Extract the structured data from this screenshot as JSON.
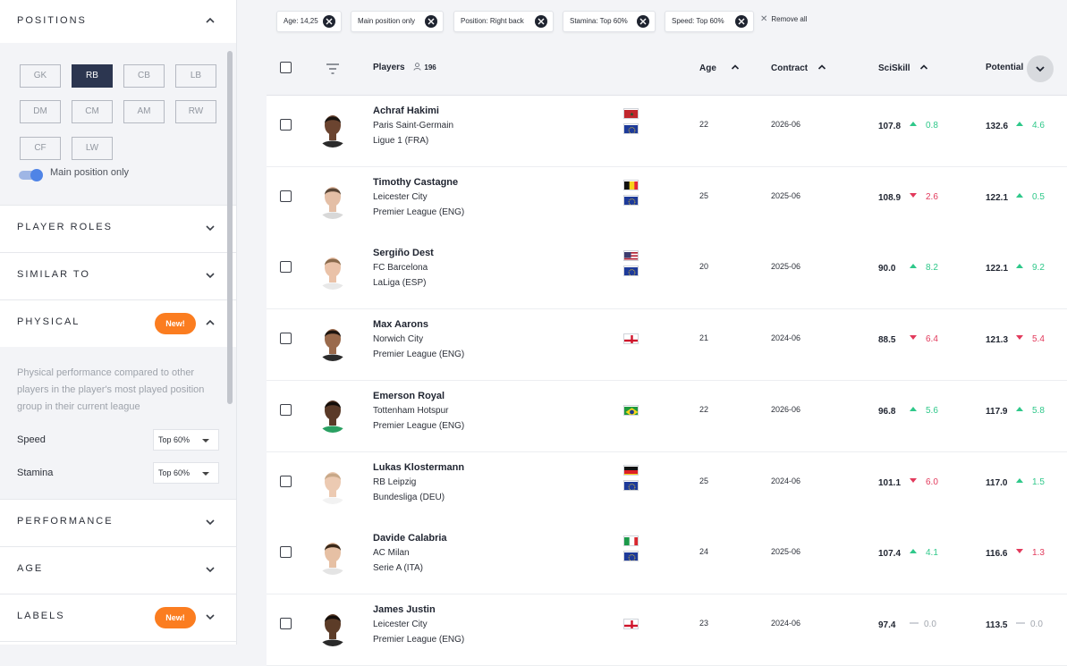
{
  "sidebar": {
    "positions": {
      "title": "POSITIONS",
      "buttons": [
        "GK",
        "RB",
        "CB",
        "LB",
        "DM",
        "CM",
        "AM",
        "RW",
        "CF",
        "LW"
      ],
      "active": "RB",
      "toggle_label": "Main position only",
      "toggle_on": true
    },
    "player_roles": {
      "title": "PLAYER ROLES"
    },
    "similar_to": {
      "title": "SIMILAR TO"
    },
    "physical": {
      "title": "PHYSICAL",
      "badge": "New!",
      "description": "Physical performance compared to other players in the player's most played position group in their current league",
      "speed_label": "Speed",
      "speed_value": "Top 60%",
      "stamina_label": "Stamina",
      "stamina_value": "Top 60%"
    },
    "performance": {
      "title": "PERFORMANCE"
    },
    "age": {
      "title": "AGE"
    },
    "labels": {
      "title": "LABELS",
      "badge": "New!"
    }
  },
  "filters": {
    "chips": [
      "Age: 14,25",
      "Main position only",
      "Position: Right back",
      "Stamina: Top 60%",
      "Speed: Top 60%"
    ],
    "remove_all": "Remove all"
  },
  "table": {
    "headers": {
      "players": "Players",
      "player_count": "196",
      "age": "Age",
      "contract": "Contract",
      "sciskill": "SciSkill",
      "potential": "Potential"
    },
    "rows": [
      {
        "name": "Achraf Hakimi",
        "club": "Paris Saint-Germain",
        "league": "Ligue 1 (FRA)",
        "flags": [
          "morocco-flag",
          "eu-flag"
        ],
        "age": "22",
        "contract": "2026-06",
        "sciskill": "107.8",
        "sciskill_delta": "0.8",
        "sciskill_dir": "up",
        "potential": "132.6",
        "potential_delta": "4.6",
        "potential_dir": "up",
        "skin": "#6b4430",
        "hair": "#1a1410",
        "shirt": "#2a2a2a"
      },
      {
        "name": "Timothy Castagne",
        "club": "Leicester City",
        "league": "Premier League (ENG)",
        "flags": [
          "belgium-flag",
          "eu-flag"
        ],
        "age": "25",
        "contract": "2025-06",
        "sciskill": "108.9",
        "sciskill_delta": "2.6",
        "sciskill_dir": "down",
        "potential": "122.1",
        "potential_delta": "0.5",
        "potential_dir": "up",
        "skin": "#e4bfa6",
        "hair": "#5a4636",
        "shirt": "#d8d8d8"
      },
      {
        "name": "Sergiño Dest",
        "club": "FC Barcelona",
        "league": "LaLiga (ESP)",
        "flags": [
          "usa-flag",
          "eu-flag"
        ],
        "age": "20",
        "contract": "2025-06",
        "sciskill": "90.0",
        "sciskill_delta": "8.2",
        "sciskill_dir": "up",
        "potential": "122.1",
        "potential_delta": "9.2",
        "potential_dir": "up",
        "skin": "#eac2a8",
        "hair": "#8a6a4c",
        "shirt": "#e8e8e8"
      },
      {
        "name": "Max Aarons",
        "club": "Norwich City",
        "league": "Premier League (ENG)",
        "flags": [
          "england-flag"
        ],
        "age": "21",
        "contract": "2024-06",
        "sciskill": "88.5",
        "sciskill_delta": "6.4",
        "sciskill_dir": "down",
        "potential": "121.3",
        "potential_delta": "5.4",
        "potential_dir": "down",
        "skin": "#9a6a4c",
        "hair": "#1e1510",
        "shirt": "#2c2c2c"
      },
      {
        "name": "Emerson Royal",
        "club": "Tottenham Hotspur",
        "league": "Premier League (ENG)",
        "flags": [
          "brazil-flag"
        ],
        "age": "22",
        "contract": "2026-06",
        "sciskill": "96.8",
        "sciskill_delta": "5.6",
        "sciskill_dir": "up",
        "potential": "117.9",
        "potential_delta": "5.8",
        "potential_dir": "up",
        "skin": "#5a3a28",
        "hair": "#140e0a",
        "shirt": "#2aa062"
      },
      {
        "name": "Lukas Klostermann",
        "club": "RB Leipzig",
        "league": "Bundesliga (DEU)",
        "flags": [
          "germany-flag",
          "eu-flag"
        ],
        "age": "25",
        "contract": "2024-06",
        "sciskill": "101.1",
        "sciskill_delta": "6.0",
        "sciskill_dir": "down",
        "potential": "117.0",
        "potential_delta": "1.5",
        "potential_dir": "up",
        "skin": "#eccab2",
        "hair": "#c8a888",
        "shirt": "#f2f2f2"
      },
      {
        "name": "Davide Calabria",
        "club": "AC Milan",
        "league": "Serie A (ITA)",
        "flags": [
          "italy-flag",
          "eu-flag"
        ],
        "age": "24",
        "contract": "2025-06",
        "sciskill": "107.4",
        "sciskill_delta": "4.1",
        "sciskill_dir": "up",
        "potential": "116.6",
        "potential_delta": "1.3",
        "potential_dir": "down",
        "skin": "#e6c0a4",
        "hair": "#3a2818",
        "shirt": "#e4e4e4"
      },
      {
        "name": "James Justin",
        "club": "Leicester City",
        "league": "Premier League (ENG)",
        "flags": [
          "england-flag"
        ],
        "age": "23",
        "contract": "2024-06",
        "sciskill": "97.4",
        "sciskill_delta": "0.0",
        "sciskill_dir": "flat",
        "potential": "113.5",
        "potential_delta": "0.0",
        "potential_dir": "flat",
        "skin": "#5c3c28",
        "hair": "#140e0a",
        "shirt": "#2a2a2a"
      }
    ]
  }
}
